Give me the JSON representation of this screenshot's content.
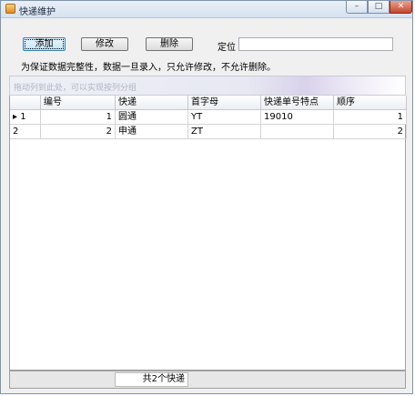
{
  "window": {
    "title": "快递维护"
  },
  "toolbar": {
    "add_label": "添加",
    "edit_label": "修改",
    "delete_label": "删除",
    "locate_label": "定位",
    "locate_value": ""
  },
  "notice": "为保证数据完整性，数据一旦录入，只允许修改，不允许删除。",
  "group_hint": "拖动列到此处，可以实现按列分组",
  "grid": {
    "columns": [
      "编号",
      "快递",
      "首字母",
      "快递单号特点",
      "顺序"
    ],
    "rows": [
      {
        "rownum": "1",
        "selected_marker": "▸",
        "id": "1",
        "name": "圆通",
        "initial": "YT",
        "feature": "19010",
        "order": "1"
      },
      {
        "rownum": "2",
        "selected_marker": "",
        "id": "2",
        "name": "申通",
        "initial": "ZT",
        "feature": "",
        "order": "2"
      }
    ]
  },
  "footer": {
    "summary": "共2个快递"
  }
}
